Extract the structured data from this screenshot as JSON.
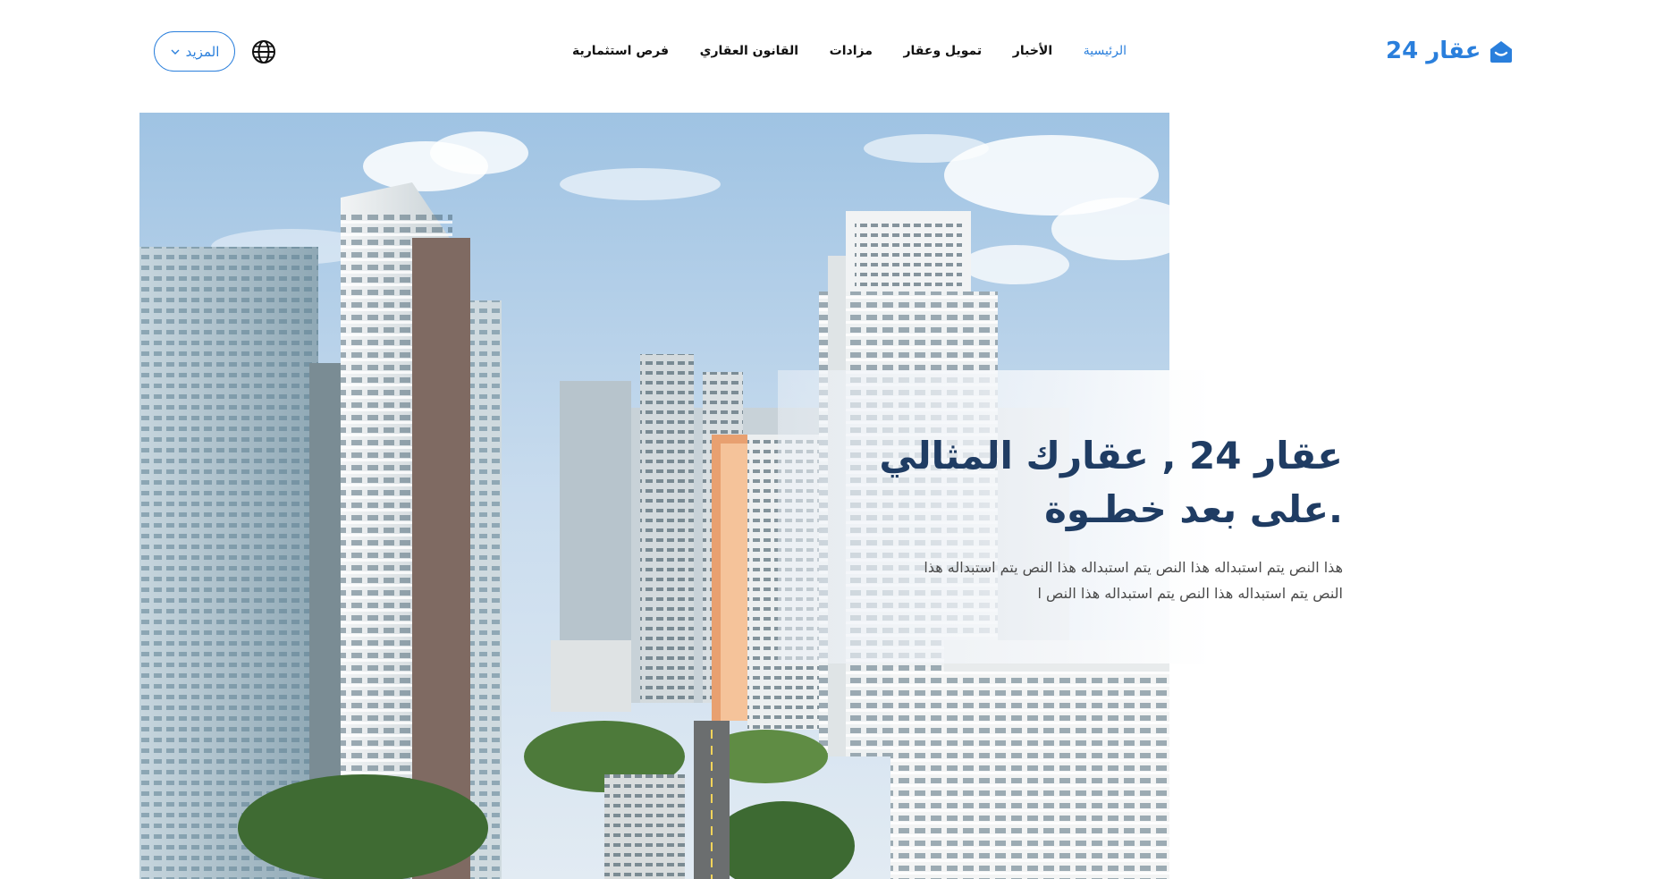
{
  "header": {
    "logo_text": "عقار 24",
    "logo_icon": "home-icon",
    "nav": [
      {
        "label": "الرئيسية",
        "active": true
      },
      {
        "label": "الأخبار",
        "active": false
      },
      {
        "label": "تمويل وعقار",
        "active": false
      },
      {
        "label": "مزادات",
        "active": false
      },
      {
        "label": "القانون العقاري",
        "active": false
      },
      {
        "label": "فرص استثمارية",
        "active": false
      }
    ],
    "language_icon": "globe-icon",
    "more_label": "المزيد",
    "more_icon": "chevron-down-icon"
  },
  "hero": {
    "title_line1": "عقار 24 , عقارك المثالي",
    "title_line2": ".على بعد خطـوة",
    "text_line1": "هذا النص يتم استبداله هذا النص يتم استبداله هذا النص يتم استبداله هذا",
    "text_line2": "النص يتم استبداله هذا النص يتم استبداله هذا النص ا",
    "image": "city-skyline-photo"
  },
  "colors": {
    "accent": "#2a7fdc",
    "title": "#1f3c63",
    "body_text": "#4a4a4a"
  }
}
